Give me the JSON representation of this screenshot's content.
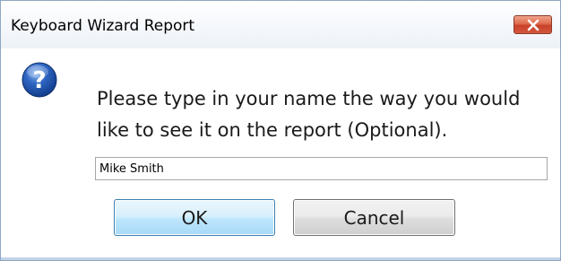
{
  "window": {
    "title": "Keyboard Wizard Report",
    "close_icon": "close-icon"
  },
  "dialog": {
    "icon": "question-icon",
    "message": "Please type in your name the way you would\nlike to see it on the report (Optional).",
    "name_input": {
      "value": "Mike Smith",
      "placeholder": ""
    },
    "buttons": {
      "ok_label": "OK",
      "cancel_label": "Cancel"
    }
  },
  "colors": {
    "close_button": "#c9412a",
    "ok_border": "#3c7fb1",
    "question_icon": "#1e4fa8"
  }
}
